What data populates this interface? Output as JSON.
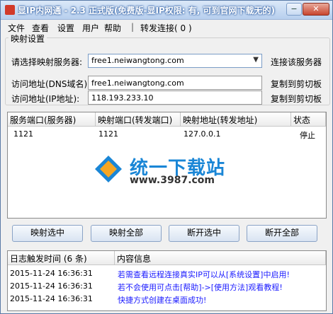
{
  "window": {
    "title": "显IP内网通 - 2.3 正式版(免费版-显IP权限: 有, 可到官网下载无的)",
    "minimize": "−",
    "close": "✕"
  },
  "menu": {
    "items": [
      "文件",
      "查看",
      "设置",
      "用户",
      "帮助"
    ],
    "separator": "|",
    "forward": "转发连接( 0 )"
  },
  "mapping": {
    "group_title": "映射设置",
    "server_label": "请选择映射服务器:",
    "server_value": "free1.neiwangtong.com",
    "connect_label": "连接该服务器",
    "dns_label": "访问地址(DNS域名):",
    "dns_value": "free1.neiwangtong.com",
    "ip_label": "访问地址(IP地址):",
    "ip_value": "118.193.233.10",
    "copy_label": "复制到剪切板"
  },
  "ports": {
    "headers": [
      "服务端口(服务器)",
      "映射端口(转发端口)",
      "映射地址(转发地址)",
      "状态"
    ],
    "rows": [
      [
        "1121",
        "1121",
        "127.0.0.1",
        "停止"
      ]
    ]
  },
  "watermark": {
    "text": "统一下载站",
    "url": "www.3987.com"
  },
  "buttons": {
    "map_selected": "映射选中",
    "map_all": "映射全部",
    "disconnect_selected": "断开选中",
    "disconnect_all": "断开全部"
  },
  "log": {
    "header_time": "日志触发时间 (6 条)",
    "header_info": "内容信息",
    "rows": [
      {
        "time": "2015-11-24 16:36:31",
        "msg": "若需查看远程连接真实IP可以从[系统设置]中启用!"
      },
      {
        "time": "2015-11-24 16:36:31",
        "msg": "若不会使用可点击[帮助]->[使用方法]观看教程!"
      },
      {
        "time": "2015-11-24 16:36:31",
        "msg": "快捷方式创建在桌面成功!"
      }
    ]
  },
  "colors": {
    "title_bar": "#b7cfee",
    "log_text": "#1a1aff",
    "watermark": "#1a86d6"
  }
}
